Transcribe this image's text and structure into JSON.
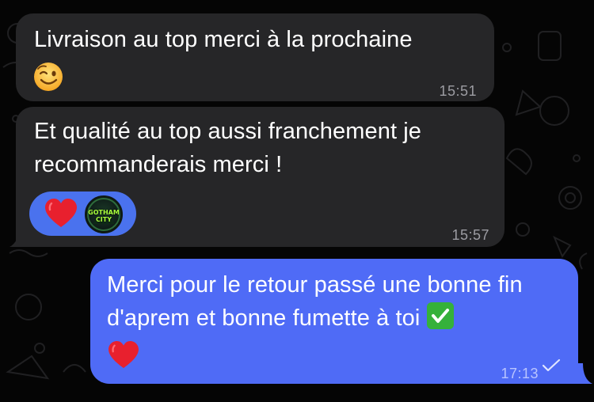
{
  "messages": [
    {
      "id": "msg-1",
      "direction": "incoming",
      "text": "Livraison au top merci à la prochaine",
      "emoji": "😉",
      "emoji_name": "wink-emoji",
      "time": "15:51"
    },
    {
      "id": "msg-2",
      "direction": "incoming",
      "text": "Et qualité au top aussi franchement je recommanderais merci !",
      "time": "15:57",
      "reactions": {
        "heart": "heart-reaction",
        "avatar_line1": "GOTHAM",
        "avatar_line2": "CITY"
      }
    },
    {
      "id": "msg-3",
      "direction": "outgoing",
      "text": "Merci pour le retour passé une bonne fin d'aprem et bonne fumette à toi",
      "emoji_inline": "check-mark-button-emoji",
      "emoji_heart": "red-heart-emoji",
      "time": "17:13",
      "status": "sent-check"
    }
  ],
  "colors": {
    "background": "#050505",
    "incoming_bubble": "#262628",
    "outgoing_bubble": "#4f6bf6",
    "reaction_pill": "#4a72ee",
    "timestamp_incoming": "#9c9ca2",
    "timestamp_outgoing": "#b9c4ff",
    "heart": "#e8202e",
    "check_green": "#35b13a"
  }
}
